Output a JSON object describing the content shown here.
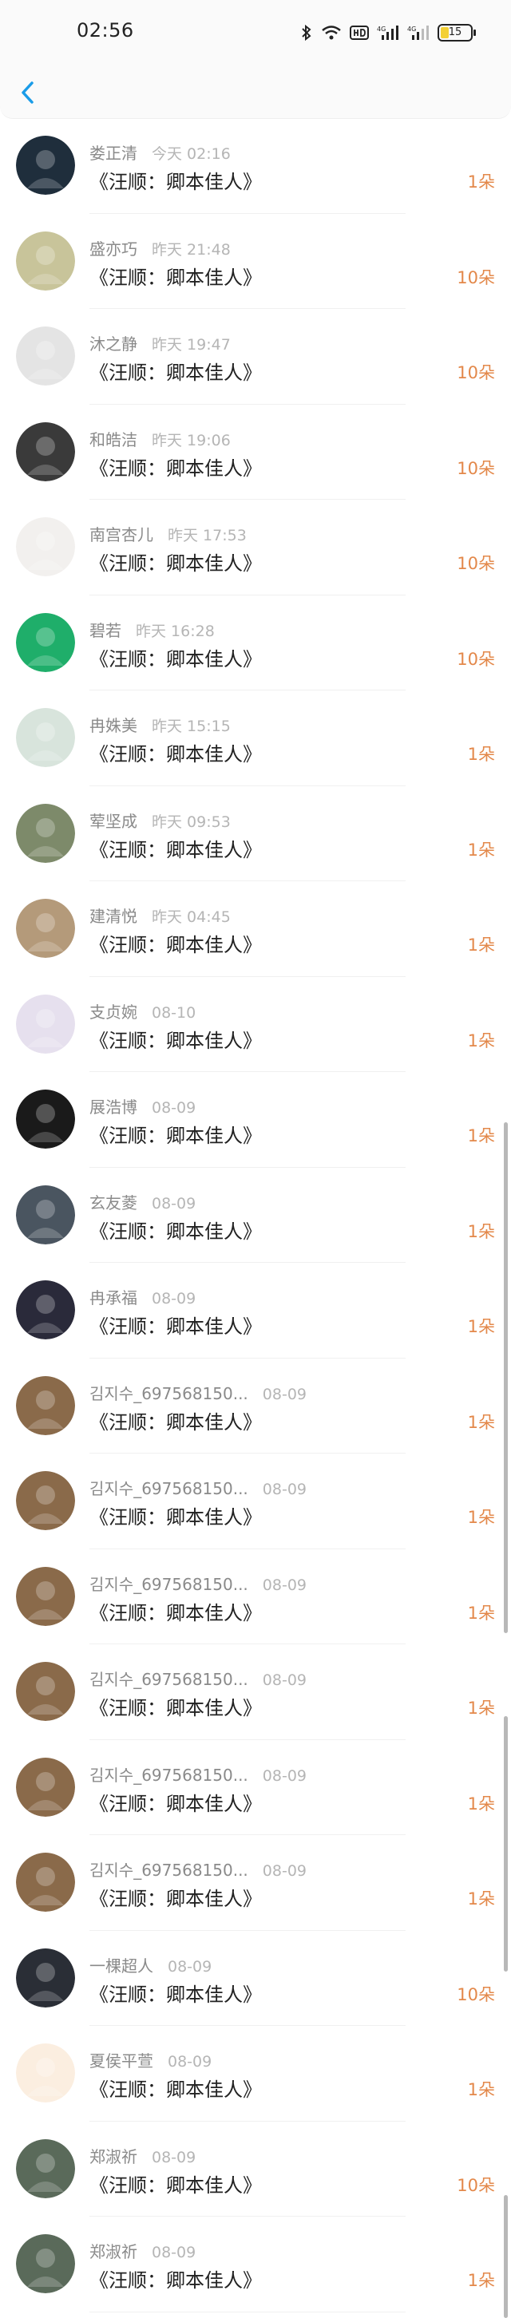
{
  "status_bar": {
    "time": "02:56",
    "battery": "15"
  },
  "gifts": [
    {
      "name": "娄正清",
      "date": "今天 02:16",
      "title": "《汪顺：卿本佳人》",
      "count": "1朵",
      "avatar_color": "#1f2e3c"
    },
    {
      "name": "盛亦巧",
      "date": "昨天 21:48",
      "title": "《汪顺：卿本佳人》",
      "count": "10朵",
      "avatar_color": "#c8c49a"
    },
    {
      "name": "沐之静",
      "date": "昨天 19:47",
      "title": "《汪顺：卿本佳人》",
      "count": "10朵",
      "avatar_color": "#e4e4e4"
    },
    {
      "name": "和皓洁",
      "date": "昨天 19:06",
      "title": "《汪顺：卿本佳人》",
      "count": "10朵",
      "avatar_color": "#3a3a3a"
    },
    {
      "name": "南宫杏儿",
      "date": "昨天 17:53",
      "title": "《汪顺：卿本佳人》",
      "count": "10朵",
      "avatar_color": "#f2f0ee"
    },
    {
      "name": "碧若",
      "date": "昨天 16:28",
      "title": "《汪顺：卿本佳人》",
      "count": "10朵",
      "avatar_color": "#1fae6a"
    },
    {
      "name": "冉姝美",
      "date": "昨天 15:15",
      "title": "《汪顺：卿本佳人》",
      "count": "1朵",
      "avatar_color": "#d8e4dc"
    },
    {
      "name": "荤坚成",
      "date": "昨天 09:53",
      "title": "《汪顺：卿本佳人》",
      "count": "1朵",
      "avatar_color": "#7d8a6a"
    },
    {
      "name": "建清悦",
      "date": "昨天 04:45",
      "title": "《汪顺：卿本佳人》",
      "count": "1朵",
      "avatar_color": "#b49a7a"
    },
    {
      "name": "支贞婉",
      "date": "08-10",
      "title": "《汪顺：卿本佳人》",
      "count": "1朵",
      "avatar_color": "#e6e0ee"
    },
    {
      "name": "展浩博",
      "date": "08-09",
      "title": "《汪顺：卿本佳人》",
      "count": "1朵",
      "avatar_color": "#1a1a1a"
    },
    {
      "name": "玄友菱",
      "date": "08-09",
      "title": "《汪顺：卿本佳人》",
      "count": "1朵",
      "avatar_color": "#4a5560"
    },
    {
      "name": "冉承福",
      "date": "08-09",
      "title": "《汪顺：卿本佳人》",
      "count": "1朵",
      "avatar_color": "#2a2a3a"
    },
    {
      "name": "김지수_697568150...",
      "date": "08-09",
      "title": "《汪顺：卿本佳人》",
      "count": "1朵",
      "avatar_color": "#8a6a4a"
    },
    {
      "name": "김지수_697568150...",
      "date": "08-09",
      "title": "《汪顺：卿本佳人》",
      "count": "1朵",
      "avatar_color": "#8a6a4a"
    },
    {
      "name": "김지수_697568150...",
      "date": "08-09",
      "title": "《汪顺：卿本佳人》",
      "count": "1朵",
      "avatar_color": "#8a6a4a"
    },
    {
      "name": "김지수_697568150...",
      "date": "08-09",
      "title": "《汪顺：卿本佳人》",
      "count": "1朵",
      "avatar_color": "#8a6a4a"
    },
    {
      "name": "김지수_697568150...",
      "date": "08-09",
      "title": "《汪顺：卿本佳人》",
      "count": "1朵",
      "avatar_color": "#8a6a4a"
    },
    {
      "name": "김지수_697568150...",
      "date": "08-09",
      "title": "《汪顺：卿本佳人》",
      "count": "1朵",
      "avatar_color": "#8a6a4a"
    },
    {
      "name": "一棵超人",
      "date": "08-09",
      "title": "《汪顺：卿本佳人》",
      "count": "10朵",
      "avatar_color": "#2a2e36"
    },
    {
      "name": "夏侯平萱",
      "date": "08-09",
      "title": "《汪顺：卿本佳人》",
      "count": "1朵",
      "avatar_color": "#fbeee0"
    },
    {
      "name": "郑淑祈",
      "date": "08-09",
      "title": "《汪顺：卿本佳人》",
      "count": "10朵",
      "avatar_color": "#5a6a5a"
    },
    {
      "name": "郑淑祈",
      "date": "08-09",
      "title": "《汪顺：卿本佳人》",
      "count": "1朵",
      "avatar_color": "#5a6a5a"
    }
  ],
  "colors": {
    "accent": "#1a9ce8",
    "count": "#e3884a"
  }
}
